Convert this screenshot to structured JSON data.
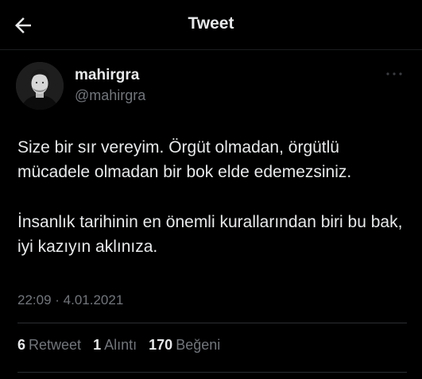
{
  "header": {
    "title": "Tweet",
    "back_icon": "arrow-left-icon"
  },
  "author": {
    "display_name": "mahirgra",
    "handle": "@mahirgra",
    "more_icon": "more-dots-icon"
  },
  "tweet": {
    "paragraphs": [
      "Size bir sır vereyim. Örgüt olmadan,  örgütlü mücadele olmadan bir bok elde edemezsiniz.",
      "İnsanlık tarihinin en önemli kurallarından biri bu bak, iyi kazıyın aklınıza."
    ],
    "timestamp": "22:09 · 4.01.2021"
  },
  "stats": {
    "retweets": {
      "count": "6",
      "label": "Retweet"
    },
    "quotes": {
      "count": "1",
      "label": "Alıntı"
    },
    "likes": {
      "count": "170",
      "label": "Beğeni"
    }
  },
  "colors": {
    "background": "#000000",
    "primary_text": "#e7e9ea",
    "secondary_text": "#71767b",
    "divider": "#2b2e31"
  }
}
